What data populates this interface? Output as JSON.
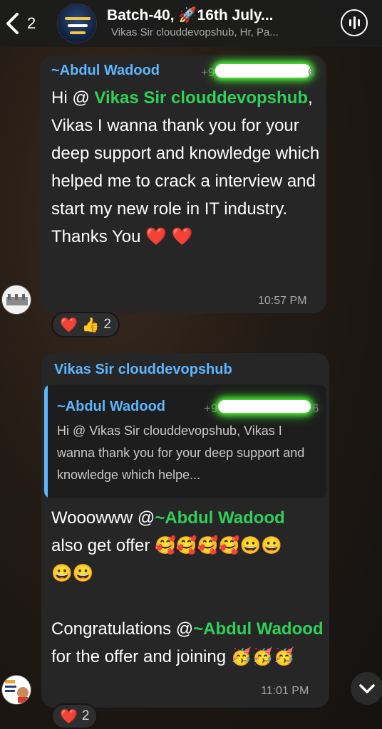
{
  "header": {
    "back_count": "2",
    "title": "Batch-40, 🚀16th July...",
    "subtitle": "Vikas Sir clouddevopshub, Hr, Pa..."
  },
  "messages": [
    {
      "sender": "~Abdul Wadood",
      "phone_start": "+9",
      "phone_end": "6",
      "text_parts": {
        "greeting": "Hi @",
        "mention": "Vikas Sir clouddevopshub",
        "body": ", Vikas I wanna thank you for your deep support and knowledge which helped me to crack a interview and start my new role in IT industry.",
        "thanks": "Thanks You"
      },
      "thanks_emoji": "❤️ ❤️",
      "time": "10:57 PM",
      "reactions": {
        "emojis": "❤️ 👍",
        "count": "2"
      }
    },
    {
      "sender": "Vikas Sir clouddevopshub",
      "quote": {
        "sender": "~Abdul Wadood",
        "phone_start": "+9",
        "phone_end": "6",
        "text": "Hi @ Vikas Sir clouddevopshub, Vikas I wanna thank you for your deep support and knowledge which helpe..."
      },
      "text_parts": {
        "wow": "Wooowww @",
        "mention1": "~Abdul Wadood",
        "line2": "also get offer",
        "emojis1": "🥰🥰🥰🥰😀😀",
        "emojis2": "😀😀",
        "congrats": "Congratulations @",
        "mention2": "~Abdul Wadood",
        "rest": " for the offer and joining",
        "emojis3": "🥳🥳🥳"
      },
      "time": "11:01 PM",
      "reactions": {
        "emojis": "❤️",
        "count": "2"
      }
    }
  ],
  "icons": [
    "chevron-left-icon",
    "voice-chat-icon",
    "chevron-down-icon"
  ]
}
